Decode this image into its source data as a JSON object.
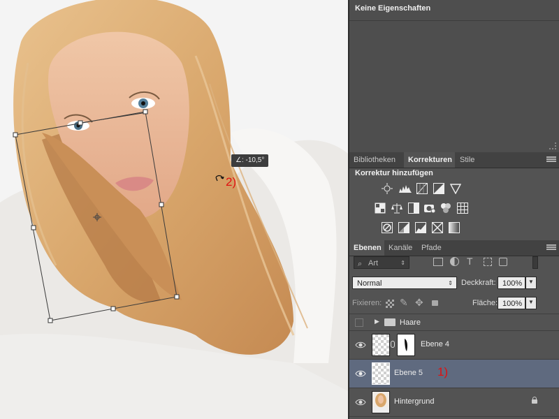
{
  "properties_panel": {
    "title": "Keine Eigenschaften"
  },
  "adjustments_panel": {
    "tabs": [
      {
        "label": "Bibliotheken",
        "active": false
      },
      {
        "label": "Korrekturen",
        "active": true
      },
      {
        "label": "Stile",
        "active": false
      }
    ],
    "heading": "Korrektur hinzufügen",
    "icon_rows": [
      [
        "brightness-icon",
        "levels-icon",
        "curves-icon",
        "exposure-icon",
        "vibrance-icon"
      ],
      [
        "hue-saturation-icon",
        "color-balance-icon",
        "black-white-icon",
        "photo-filter-icon",
        "channel-mixer-icon",
        "color-lookup-icon"
      ],
      [
        "invert-icon",
        "posterize-icon",
        "threshold-icon",
        "selective-color-icon",
        "gradient-map-icon"
      ]
    ]
  },
  "layers_panel": {
    "tabs": [
      {
        "label": "Ebenen",
        "active": true
      },
      {
        "label": "Kanäle",
        "active": false
      },
      {
        "label": "Pfade",
        "active": false
      }
    ],
    "filter_label": "Art",
    "blend_mode": "Normal",
    "opacity_label": "Deckkraft:",
    "opacity_value": "100%",
    "lock_label": "Fixieren:",
    "fill_label": "Fläche:",
    "fill_value": "100%",
    "layers": [
      {
        "name": "Haare",
        "type": "group",
        "visible": false,
        "selected": false,
        "locked": false
      },
      {
        "name": "Ebene 4",
        "type": "layer-with-mask",
        "visible": true,
        "selected": false,
        "locked": false
      },
      {
        "name": "Ebene 5",
        "type": "layer",
        "visible": true,
        "selected": true,
        "locked": false
      },
      {
        "name": "Hintergrund",
        "type": "background",
        "visible": true,
        "selected": false,
        "locked": true
      }
    ]
  },
  "canvas": {
    "rotation_readout": "∠: -10,5°",
    "annotation_1": "1)",
    "annotation_2": "2)",
    "colors": {
      "annotation": "#e01010",
      "selection_highlight": "#5f6a7f"
    }
  }
}
